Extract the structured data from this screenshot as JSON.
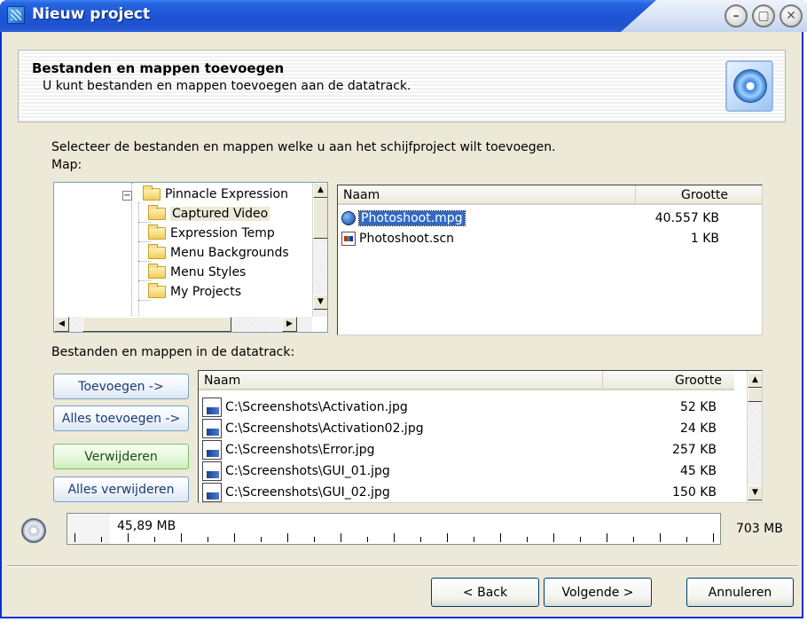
{
  "window": {
    "title": "Nieuw project"
  },
  "header": {
    "title": "Bestanden en mappen toevoegen",
    "subtitle": "U kunt bestanden en mappen toevoegen aan de datatrack."
  },
  "instruction": "Selecteer de bestanden en mappen welke u aan het schijfproject wilt toevoegen.",
  "map_label": "Map:",
  "tree": {
    "items": [
      {
        "label": "Pinnacle Expression",
        "expanded": true
      },
      {
        "label": "Captured Video",
        "selected": true
      },
      {
        "label": "Expression Temp"
      },
      {
        "label": "Menu Backgrounds"
      },
      {
        "label": "Menu Styles"
      },
      {
        "label": "My Projects"
      }
    ]
  },
  "file_list": {
    "columns": {
      "name": "Naam",
      "size": "Grootte"
    },
    "rows": [
      {
        "name": "Photoshoot.mpg",
        "size": "40.557 KB",
        "selected": true,
        "icon": "video-file-icon"
      },
      {
        "name": "Photoshoot.scn",
        "size": "1 KB",
        "icon": "scene-file-icon"
      }
    ]
  },
  "datatrack_label": "Bestanden en mappen in de datatrack:",
  "buttons": {
    "add": "Toevoegen ->",
    "add_all": "Alles toevoegen ->",
    "remove": "Verwijderen",
    "remove_all": "Alles verwijderen"
  },
  "datatrack_list": {
    "columns": {
      "name": "Naam",
      "size": "Grootte"
    },
    "rows": [
      {
        "name": "C:\\Screenshots\\Activation.jpg",
        "size": "52 KB"
      },
      {
        "name": "C:\\Screenshots\\Activation02.jpg",
        "size": "24 KB"
      },
      {
        "name": "C:\\Screenshots\\Error.jpg",
        "size": "257 KB"
      },
      {
        "name": "C:\\Screenshots\\GUI_01.jpg",
        "size": "45 KB"
      },
      {
        "name": "C:\\Screenshots\\GUI_02.jpg",
        "size": "150 KB"
      }
    ]
  },
  "capacity": {
    "used": "45,89 MB",
    "total": "703 MB",
    "used_fraction": 0.065
  },
  "nav": {
    "back": "< Back",
    "next": "Volgende >",
    "cancel": "Annuleren"
  },
  "colors": {
    "titlebar": "#1d55d6",
    "window_bg": "#ece9d8",
    "selection": "#316ac5"
  }
}
